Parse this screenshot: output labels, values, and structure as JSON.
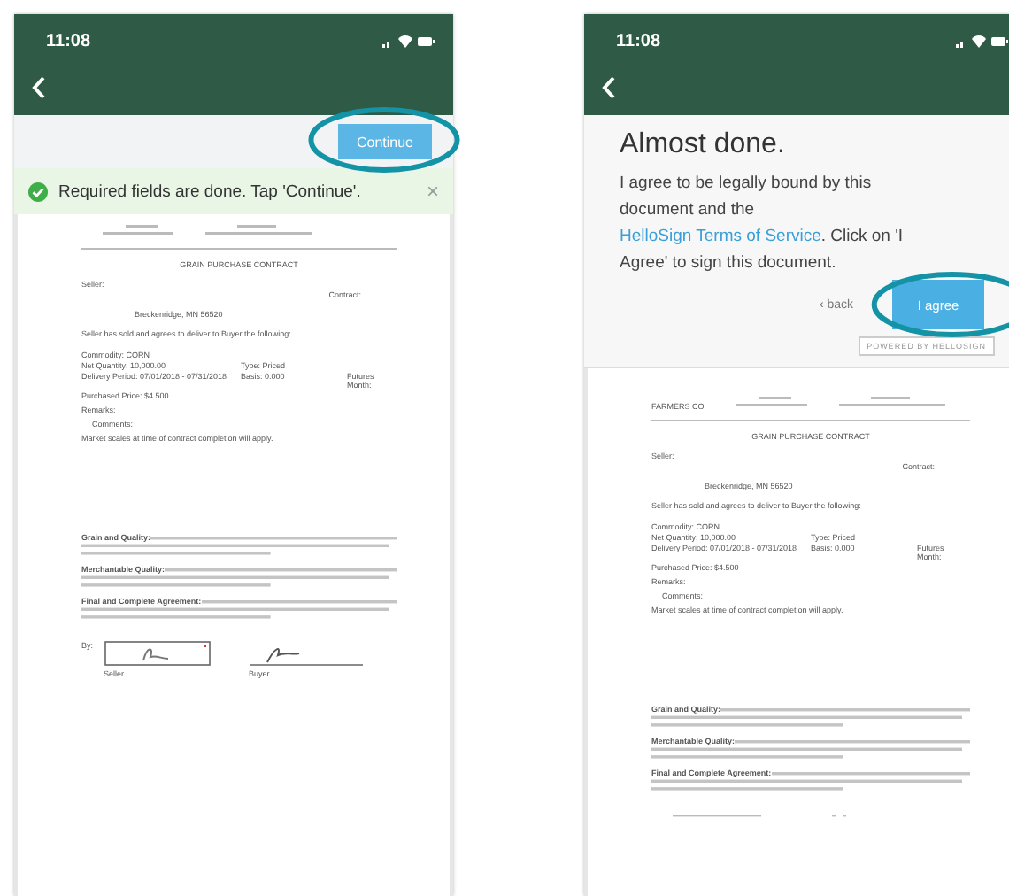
{
  "screens": [
    {
      "kind": "continue",
      "time": "11:08",
      "action": {
        "label": "Continue"
      },
      "notice": {
        "text": "Required fields are done. Tap 'Continue'.",
        "close": "×"
      },
      "document": {
        "title": "GRAIN PURCHASE CONTRACT",
        "seller_label": "Seller:",
        "contract_label": "Contract:",
        "location": "Breckenridge, MN 56520",
        "intro": "Seller has sold and agrees to deliver to Buyer the following:",
        "terms": [
          [
            "Commodity:  CORN"
          ],
          [
            "Net Quantity:  10,000.00",
            "Type: Priced"
          ],
          [
            "Delivery Period: 07/01/2018 - 07/31/2018",
            "Basis: 0.000",
            "Futures Month:"
          ],
          [
            "Purchased Price:  $4.500"
          ]
        ],
        "remarks": "Remarks:",
        "comments": "Comments:",
        "scales": "Market scales at time of contract completion will apply.",
        "clauses": [
          "Grain and Quality:",
          "Merchantable Quality:",
          "Final and Complete Agreement:"
        ],
        "signature": {
          "by": "By:",
          "seller": "Seller",
          "buyer": "Buyer"
        }
      }
    },
    {
      "kind": "agree",
      "time": "11:08",
      "panel": {
        "title": "Almost done.",
        "text_before": "I agree to be legally bound by this document and the ",
        "link": "HelloSign Terms of Service",
        "text_after": ". Click on 'I Agree' to sign this document.",
        "back": "‹ back",
        "agree": "I agree",
        "powered": "POWERED BY HELLOSIGN"
      },
      "document": {
        "company": "FARMERS CO",
        "title": "GRAIN PURCHASE CONTRACT",
        "seller_label": "Seller:",
        "contract_label": "Contract:",
        "location": "Breckenridge, MN 56520",
        "intro": "Seller has sold and agrees to deliver to Buyer the following:",
        "terms": [
          [
            "Commodity:  CORN"
          ],
          [
            "Net Quantity:  10,000.00",
            "Type: Priced"
          ],
          [
            "Delivery Period: 07/01/2018 - 07/31/2018",
            "Basis: 0.000",
            "Futures Month:"
          ],
          [
            "Purchased Price:  $4.500"
          ]
        ],
        "remarks": "Remarks:",
        "comments": "Comments:",
        "scales": "Market scales at time of contract completion will apply.",
        "clauses": [
          "Grain and Quality:",
          "Merchantable Quality:",
          "Final and Complete Agreement:"
        ]
      }
    }
  ]
}
